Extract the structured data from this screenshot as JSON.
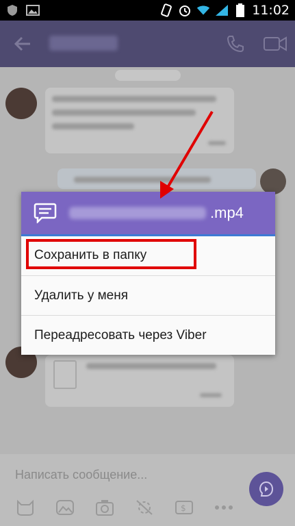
{
  "status_bar": {
    "time": "11:02"
  },
  "app_bar": {
    "back_icon": "arrow-left-icon",
    "call_icon": "phone-icon",
    "video_icon": "video-camera-icon"
  },
  "dialog": {
    "header_icon": "chat-bubble-icon",
    "file_extension": ".mp4",
    "items": [
      {
        "label": "Сохранить в папку"
      },
      {
        "label": "Удалить у меня"
      },
      {
        "label": "Переадресовать через Viber"
      }
    ]
  },
  "composer": {
    "placeholder": "Написать сообщение...",
    "icons": [
      "sticker-icon",
      "gallery-icon",
      "camera-icon",
      "doodle-icon",
      "wallet-icon",
      "more-icon"
    ],
    "send_icon": "send-icon"
  },
  "annotation": {
    "arrow_color": "#e00000",
    "highlight_color": "#e00000"
  },
  "colors": {
    "accent": "#7b66c2",
    "app_bar_dimmed": "#4e4a70"
  }
}
